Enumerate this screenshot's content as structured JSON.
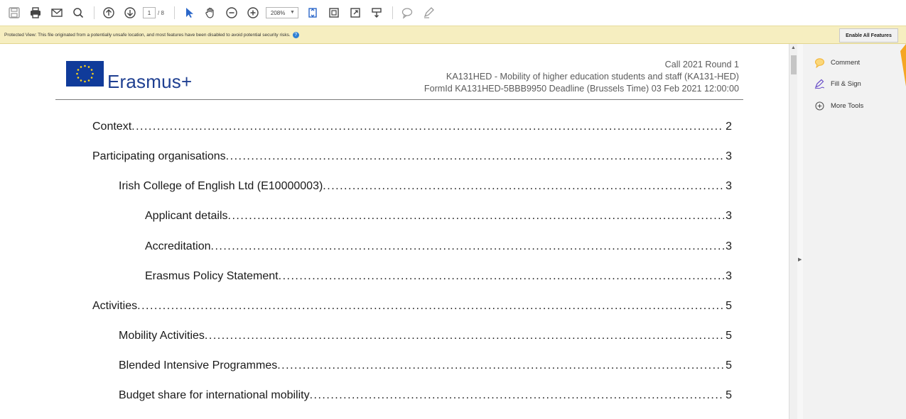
{
  "toolbar": {
    "page_current": "1",
    "page_total": "/ 8",
    "zoom": "208%"
  },
  "protected_bar": {
    "message": "Protected View: This file originated from a potentially unsafe location, and most features have been disabled to avoid potential security risks.",
    "enable_label": "Enable All Features"
  },
  "document": {
    "logo_text": "Erasmus+",
    "header_lines": [
      "Call 2021 Round 1",
      "KA131HED - Mobility of higher education students and staff (KA131-HED)",
      "FormId KA131HED-5BBB9950 Deadline (Brussels Time) 03 Feb 2021 12:00:00"
    ],
    "toc": [
      {
        "title": "Context",
        "page": "2",
        "level": 0
      },
      {
        "title": "Participating organisations",
        "page": "3",
        "level": 0
      },
      {
        "title": "Irish College of English Ltd (E10000003)",
        "page": "3",
        "level": 1
      },
      {
        "title": "Applicant details",
        "page": "3",
        "level": 2
      },
      {
        "title": "Accreditation",
        "page": "3",
        "level": 2
      },
      {
        "title": "Erasmus Policy Statement",
        "page": "3",
        "level": 2
      },
      {
        "title": "Activities",
        "page": "5",
        "level": 0
      },
      {
        "title": "Mobility Activities",
        "page": "5",
        "level": 1
      },
      {
        "title": "Blended Intensive Programmes",
        "page": "5",
        "level": 1
      },
      {
        "title": "Budget share for international mobility",
        "page": "5",
        "level": 1
      }
    ]
  },
  "right_panel": {
    "tools": [
      {
        "label": "Comment",
        "icon": "comment-icon"
      },
      {
        "label": "Fill & Sign",
        "icon": "fill-sign-icon"
      },
      {
        "label": "More Tools",
        "icon": "more-tools-icon"
      }
    ]
  },
  "colors": {
    "protected_bar_bg": "#f6eec0",
    "brand_blue": "#1e3f91",
    "toolbar_blue": "#2b67c9",
    "comment_yellow": "#f2b331",
    "panel_accent": "#f5a623"
  }
}
